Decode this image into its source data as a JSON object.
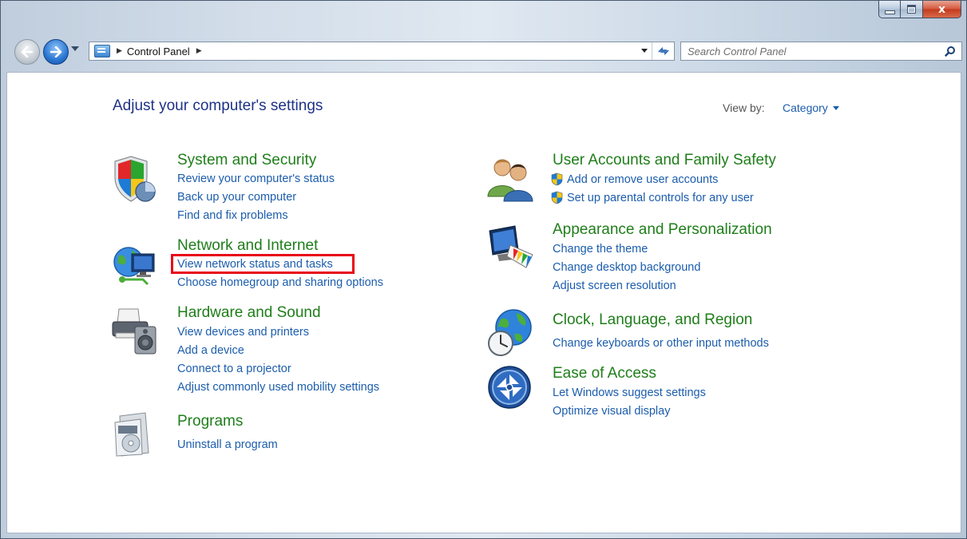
{
  "window": {
    "minimize_label": "",
    "maximize_label": "",
    "close_label": "x"
  },
  "nav": {
    "breadcrumb": [
      "Control Panel"
    ],
    "search_placeholder": "Search Control Panel"
  },
  "main": {
    "title": "Adjust your computer's settings",
    "view_by_label": "View by:",
    "view_by_value": "Category",
    "left_column": [
      {
        "title": "System and Security",
        "icon": "shield-icon",
        "links": [
          "Review your computer's status",
          "Back up your computer",
          "Find and fix problems"
        ]
      },
      {
        "title": "Network and Internet",
        "icon": "network-globe-icon",
        "links": [
          "View network status and tasks",
          "Choose homegroup and sharing options"
        ]
      },
      {
        "title": "Hardware and Sound",
        "icon": "printer-speaker-icon",
        "links": [
          "View devices and printers",
          "Add a device",
          "Connect to a projector",
          "Adjust commonly used mobility settings"
        ]
      },
      {
        "title": "Programs",
        "icon": "programs-disc-icon",
        "links": [
          "Uninstall a program"
        ]
      }
    ],
    "right_column": [
      {
        "title": "User Accounts and Family Safety",
        "icon": "users-icon",
        "links": [
          "Add or remove user accounts",
          "Set up parental controls for any user"
        ]
      },
      {
        "title": "Appearance and Personalization",
        "icon": "monitor-palette-icon",
        "links": [
          "Change the theme",
          "Change desktop background",
          "Adjust screen resolution"
        ]
      },
      {
        "title": "Clock, Language, and Region",
        "icon": "globe-clock-icon",
        "links": [
          "Change keyboards or other input methods"
        ]
      },
      {
        "title": "Ease of Access",
        "icon": "ease-of-access-icon",
        "links": [
          "Let Windows suggest settings",
          "Optimize visual display"
        ]
      }
    ],
    "highlighted_link": "View network status and tasks"
  },
  "colors": {
    "category_title": "#1f7e1a",
    "link": "#1c5dac",
    "page_title": "#1e3287",
    "highlight": "#e8061a"
  }
}
